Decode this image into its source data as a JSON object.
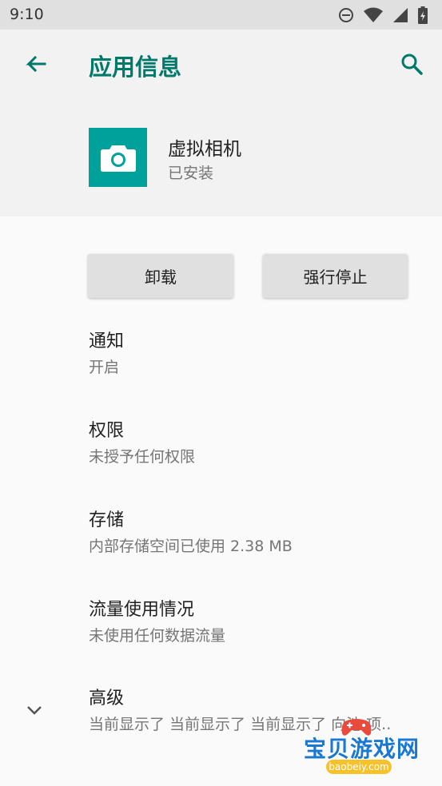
{
  "status_bar": {
    "time": "9:10",
    "icons": [
      "do-not-disturb-icon",
      "wifi-icon",
      "signal-icon",
      "battery-icon"
    ]
  },
  "header": {
    "title": "应用信息",
    "back_icon": "arrow-left-icon",
    "search_icon": "search-icon",
    "accent_color": "#00796b"
  },
  "app": {
    "name": "虚拟相机",
    "status": "已安装",
    "icon": "camera-icon",
    "icon_bg": "#00a19a"
  },
  "buttons": {
    "uninstall": "卸载",
    "force_stop": "强行停止"
  },
  "settings": [
    {
      "title": "通知",
      "subtitle": "开启"
    },
    {
      "title": "权限",
      "subtitle": "未授予任何权限"
    },
    {
      "title": "存储",
      "subtitle": "内部存储空间已使用 2.38 MB"
    },
    {
      "title": "流量使用情况",
      "subtitle": "未使用任何数据流量"
    },
    {
      "title": "高级",
      "subtitle": "当前显示了 当前显示了 当前显示了 向池 项.."
    }
  ],
  "watermark": {
    "text": "宝贝游戏网",
    "url": "baobeiy.com"
  }
}
